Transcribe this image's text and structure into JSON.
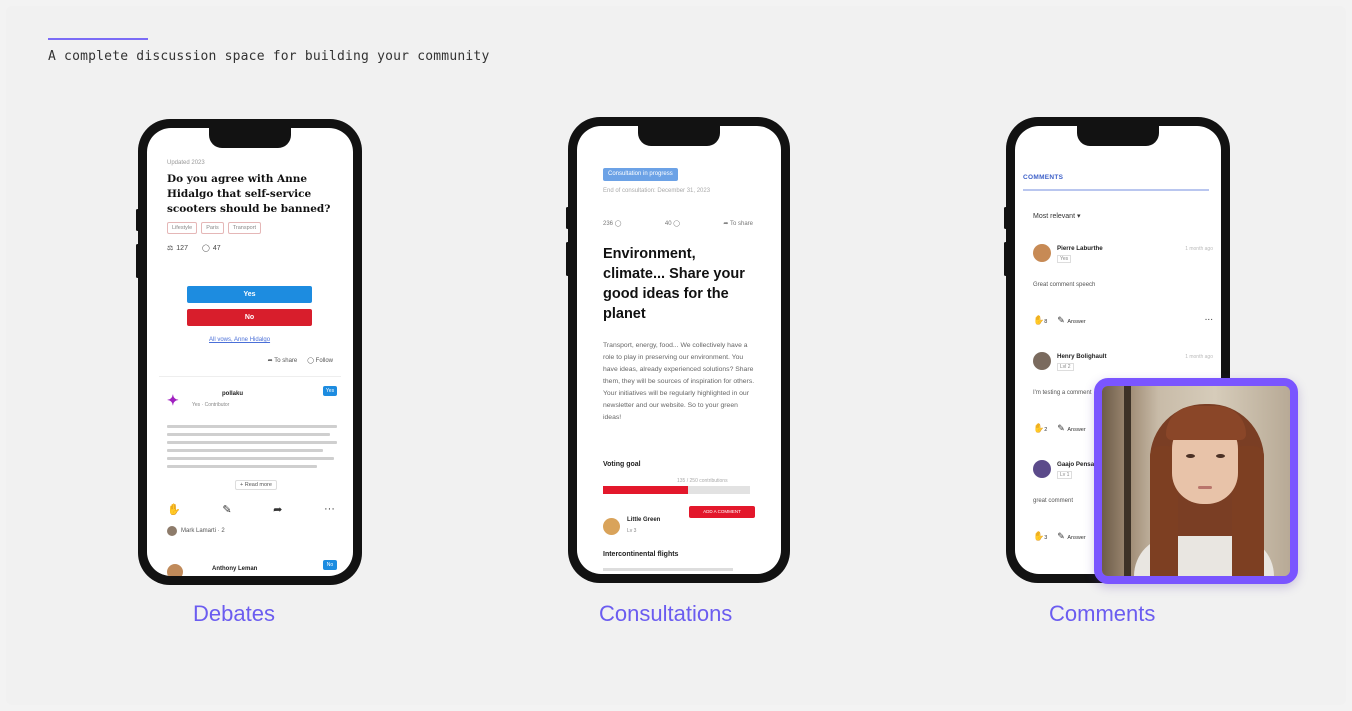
{
  "header": {
    "tagline": "A complete discussion space for building your community"
  },
  "captions": {
    "debates": "Debates",
    "consultations": "Consultations",
    "comments": "Comments"
  },
  "debates": {
    "date": "Updated 2023",
    "title": "Do you agree with Anne Hidalgo that self-service scooters should be banned?",
    "tags": [
      "Lifestyle",
      "Paris",
      "Transport"
    ],
    "stats": {
      "votes": "127",
      "comments": "47"
    },
    "yes_label": "Yes",
    "no_label": "No",
    "link_label": "All vows, Anne Hidalgo",
    "actions": {
      "share": "To share",
      "follow": "Follow"
    },
    "post": {
      "author": "pollaku",
      "badges": "Yes · Contributor",
      "follow": "Yes"
    },
    "read_more": "+ Read more",
    "reacted": "Mark Lamarti · 2",
    "post2": {
      "author": "Anthony Leman",
      "follow": "No"
    }
  },
  "consultations": {
    "label": "Consultation in progress",
    "date": "End of consultation: December 31, 2023",
    "meta": {
      "likes": "236",
      "comments": "40",
      "share": "To share"
    },
    "title": "Environment, climate... Share your good ideas for the planet",
    "body": "Transport, energy, food... We collectively have a role to play in preserving our environment. You have ideas, already experienced solutions? Share them, they will be sources of inspiration for others. Your initiatives will be regularly highlighted in our newsletter and our website. So to your green ideas!",
    "goal_label": "Voting goal",
    "goal_caption": "135 / 250 contributions",
    "goal_progress": 0.58,
    "author": "Little Green",
    "author_badge": "Lv 3",
    "cta": "ADD A COMMENT",
    "sub_title": "Intercontinental flights"
  },
  "comments": {
    "tab": "COMMENTS",
    "sort": "Most relevant",
    "items": [
      {
        "name": "Pierre Laburthe",
        "badge": "Yes",
        "time": "1 month ago",
        "text": "Great comment speech",
        "react": "8",
        "reply": "Answer",
        "color": "#c78a55"
      },
      {
        "name": "Henry Bolighault",
        "badge": "Lvl 2",
        "time": "1 month ago",
        "text": "I'm testing a comment",
        "react": "2",
        "reply": "Answer",
        "color": "#7a6a5e"
      },
      {
        "name": "Gaajo Pensa",
        "badge": "Lv 1",
        "time": "",
        "text": "great comment",
        "react": "3",
        "reply": "Answer",
        "color": "#5b4a8a"
      }
    ],
    "more": "..."
  }
}
